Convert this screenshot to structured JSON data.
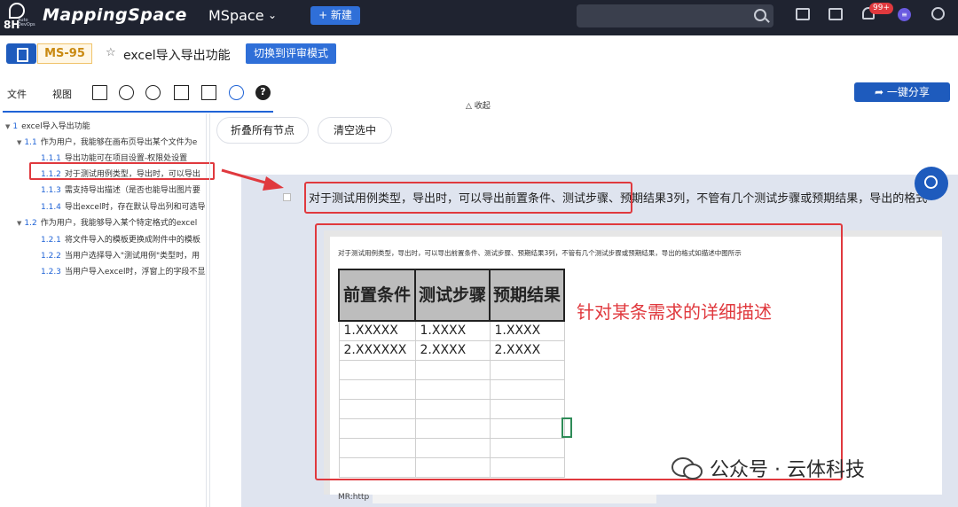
{
  "topbar": {
    "logo_mark": "8H",
    "logo_sub": "Auto DevOps",
    "brand": "MappingSpace",
    "space": "MSpace",
    "new_button": "+ 新建",
    "badge": "99+"
  },
  "header": {
    "id_tag": "MS-95",
    "title": "excel导入导出功能",
    "review_button": "切换到评审模式"
  },
  "toolbar": {
    "file_menu": "文件",
    "view_menu": "视图",
    "collapse_label": "收起",
    "share_button": "一键分享",
    "collapse_all": "折叠所有节点",
    "clear_selection": "清空选中"
  },
  "outline": {
    "items": [
      {
        "num": "1",
        "text": "excel导入导出功能"
      },
      {
        "num": "1.1",
        "text": "作为用户，我能够在画布页导出某个文件为e"
      },
      {
        "num": "1.1.1",
        "text": "导出功能可在项目设置-权限处设置"
      },
      {
        "num": "1.1.2",
        "text": "对于测试用例类型，导出时，可以导出"
      },
      {
        "num": "1.1.3",
        "text": "需支持导出描述（是否也能导出图片要"
      },
      {
        "num": "1.1.4",
        "text": "导出excel时，存在默认导出列和可选导"
      },
      {
        "num": "1.2",
        "text": "作为用户，我能够导入某个特定格式的excel"
      },
      {
        "num": "1.2.1",
        "text": "将文件导入的模板更换成附件中的模板"
      },
      {
        "num": "1.2.2",
        "text": "当用户选择导入\"测试用例\"类型时，用"
      },
      {
        "num": "1.2.3",
        "text": "当用户导入excel时，浮窗上的字段不显"
      }
    ]
  },
  "canvas": {
    "node_text": "对于测试用例类型，导出时，可以导出前置条件、测试步骤、预期结果3列，不管有几个测试步骤或预期结果，导出的格式",
    "sheet_caption": "对于测试用例类型，导出时，可以导出前置条件、测试步骤、预期结果3列，不管有几个测试步骤或预期结果，导出的格式如描述中图所示",
    "table": {
      "headers": [
        "前置条件",
        "测试步骤",
        "预期结果"
      ],
      "rows": [
        [
          "1.XXXXX",
          "1.XXXX",
          "1.XXXX"
        ],
        [
          "2.XXXXXX",
          "2.XXXX",
          "2.XXXX"
        ]
      ]
    },
    "annotation": "针对某条需求的详细描述",
    "mr_prefix": "MR:http"
  },
  "watermark": {
    "text": "公众号 · 云体科技"
  },
  "colors": {
    "topbar": "#1f2330",
    "primary": "#1e5bbd",
    "highlight": "#e0393e",
    "canvas": "#dfe4ef"
  }
}
